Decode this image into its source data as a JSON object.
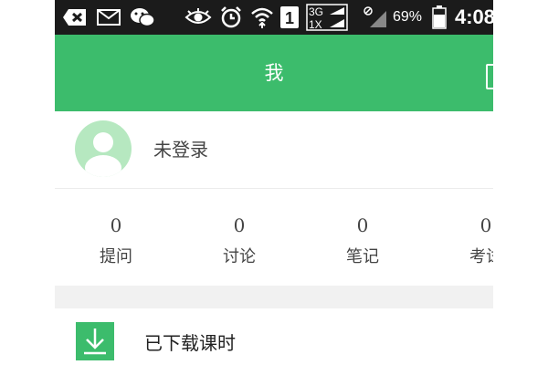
{
  "status_bar": {
    "network_top": "3G",
    "network_bottom": "1X",
    "sim_slot": "1",
    "battery": "69%",
    "time": "4:08",
    "icons": [
      "sms-icon",
      "email-icon",
      "wechat-icon",
      "eye-icon",
      "alarm-icon",
      "wifi-icon",
      "sim-icon",
      "cellular-icon",
      "no-signal-icon",
      "battery-icon"
    ]
  },
  "header": {
    "title": "我"
  },
  "profile": {
    "login_status": "未登录"
  },
  "stats": [
    {
      "count": "0",
      "label": "提问"
    },
    {
      "count": "0",
      "label": "讨论"
    },
    {
      "count": "0",
      "label": "笔记"
    },
    {
      "count": "0",
      "label": "考试"
    }
  ],
  "menu": [
    {
      "label": "已下载课时",
      "icon": "download-icon"
    }
  ],
  "colors": {
    "accent": "#3cbc6c",
    "status_bar": "#1b1b1b",
    "avatar_bg": "#b6e8c0"
  }
}
